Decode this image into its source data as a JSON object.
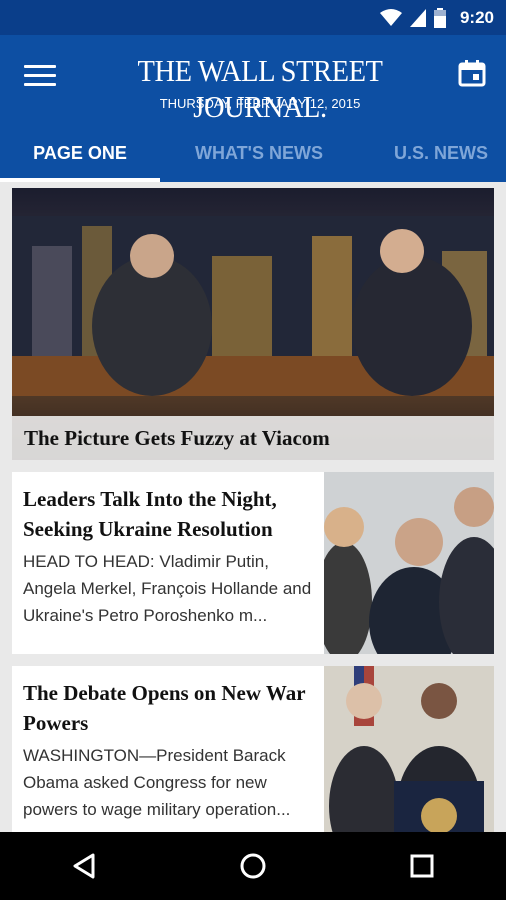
{
  "status_bar": {
    "time": "9:20"
  },
  "app_bar": {
    "masthead": "THE WALL STREET JOURNAL.",
    "date": "THURSDAY, FEBRUARY 12, 2015"
  },
  "tabs": [
    {
      "label": "PAGE ONE",
      "active": true
    },
    {
      "label": "WHAT'S NEWS",
      "active": false
    },
    {
      "label": "U.S. NEWS",
      "active": false
    }
  ],
  "feed": {
    "hero": {
      "headline": "The Picture Gets Fuzzy at Viacom"
    },
    "articles": [
      {
        "headline": "Leaders Talk Into the Night, Seeking Ukraine Resolution",
        "summary": "HEAD TO HEAD: Vladimir Putin, Angela Merkel, François Hollande and Ukraine's Petro Poroshenko m..."
      },
      {
        "headline": "The Debate Opens on New War Powers",
        "summary": "WASHINGTON—President Barack Obama asked Congress for new powers to wage military operation..."
      }
    ]
  },
  "colors": {
    "status_bar": "#0a3e8a",
    "app_bar": "#0d4fa3",
    "inactive_tab": "#7fa6d8"
  }
}
